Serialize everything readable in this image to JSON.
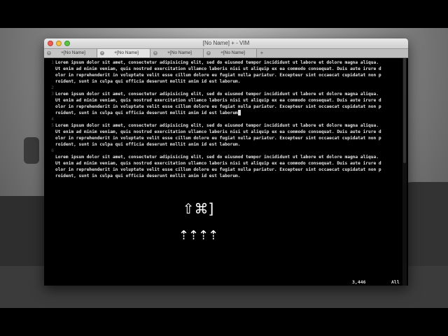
{
  "window": {
    "title": "[No Name] + - VIM"
  },
  "tabs": [
    {
      "label": "+[No Name]"
    },
    {
      "label": "+[No Name]"
    },
    {
      "label": "+[No Name]"
    },
    {
      "label": "+[No Name]"
    }
  ],
  "tab_add_label": "+",
  "lines": [
    {
      "num": "1",
      "text": "Lorem ipsum dolor sit amet, consectetur adipisicing elit, sed do eiusmod tempor incididunt ut labore et dolore magna aliqua."
    },
    {
      "num": "",
      "text": "Ut enim ad minim veniam, quis nostrud exercitation ullamco laboris nisi ut aliquip ex ea commodo consequat. Duis aute irure d"
    },
    {
      "num": "",
      "text": "olor in reprehenderit in voluptate velit esse cillum dolore eu fugiat nulla pariatur. Excepteur sint occaecat cupidatat non p"
    },
    {
      "num": "",
      "text": "roident, sunt in culpa qui officia deserunt mollit anim id est laborum."
    },
    {
      "num": "2",
      "text": ""
    },
    {
      "num": "3",
      "text": "Lorem ipsum dolor sit amet, consectetur adipisicing elit, sed do eiusmod tempor incididunt ut labore et dolore magna aliqua."
    },
    {
      "num": "",
      "text": "Ut enim ad minim veniam, quis nostrud exercitation ullamco laboris nisi ut aliquip ex ea commodo consequat. Duis aute irure d"
    },
    {
      "num": "",
      "text": "olor in reprehenderit in voluptate velit esse cillum dolore eu fugiat nulla pariatur. Excepteur sint occaecat cupidatat non p"
    },
    {
      "num": "",
      "text": "roident, sunt in culpa qui officia deserunt mollit anim id est laborum"
    },
    {
      "num": "4",
      "text": ""
    },
    {
      "num": "5",
      "text": "Lorem ipsum dolor sit amet, consectetur adipisicing elit, sed do eiusmod tempor incididunt ut labore et dolore magna aliqua."
    },
    {
      "num": "",
      "text": "Ut enim ad minim veniam, quis nostrud exercitation ullamco laboris nisi ut aliquip ex ea commodo consequat. Duis aute irure d"
    },
    {
      "num": "",
      "text": "olor in reprehenderit in voluptate velit esse cillum dolore eu fugiat nulla pariatur. Excepteur sint occaecat cupidatat non p"
    },
    {
      "num": "",
      "text": "roident, sunt in culpa qui officia deserunt mollit anim id est laborum."
    },
    {
      "num": "6",
      "text": ""
    },
    {
      "num": "",
      "text": "Lorem ipsum dolor sit amet, consectetur adipisicing elit, sed do eiusmod tempor incididunt ut labore et dolore magna aliqua."
    },
    {
      "num": "",
      "text": "Ut enim ad minim veniam, quis nostrud exercitation ullamco laboris nisi ut aliquip ex ea commodo consequat. Duis aute irure d"
    },
    {
      "num": "",
      "text": "olor in reprehenderit in voluptate velit esse cillum dolore eu fugiat nulla pariatur. Excepteur sint occaecat cupidatat non p"
    },
    {
      "num": "",
      "text": "roident, sunt in culpa qui officia deserunt mollit anim id est laborum."
    }
  ],
  "overlay": {
    "shortcut": "⇧⌘]",
    "arrows": "⇡⇡⇡⇡"
  },
  "status": {
    "position": "3,446",
    "scroll": "All"
  },
  "icons": {
    "close": "close-icon",
    "minimize": "minimize-icon",
    "zoom": "zoom-icon",
    "tab_close": "tab-close-icon"
  }
}
